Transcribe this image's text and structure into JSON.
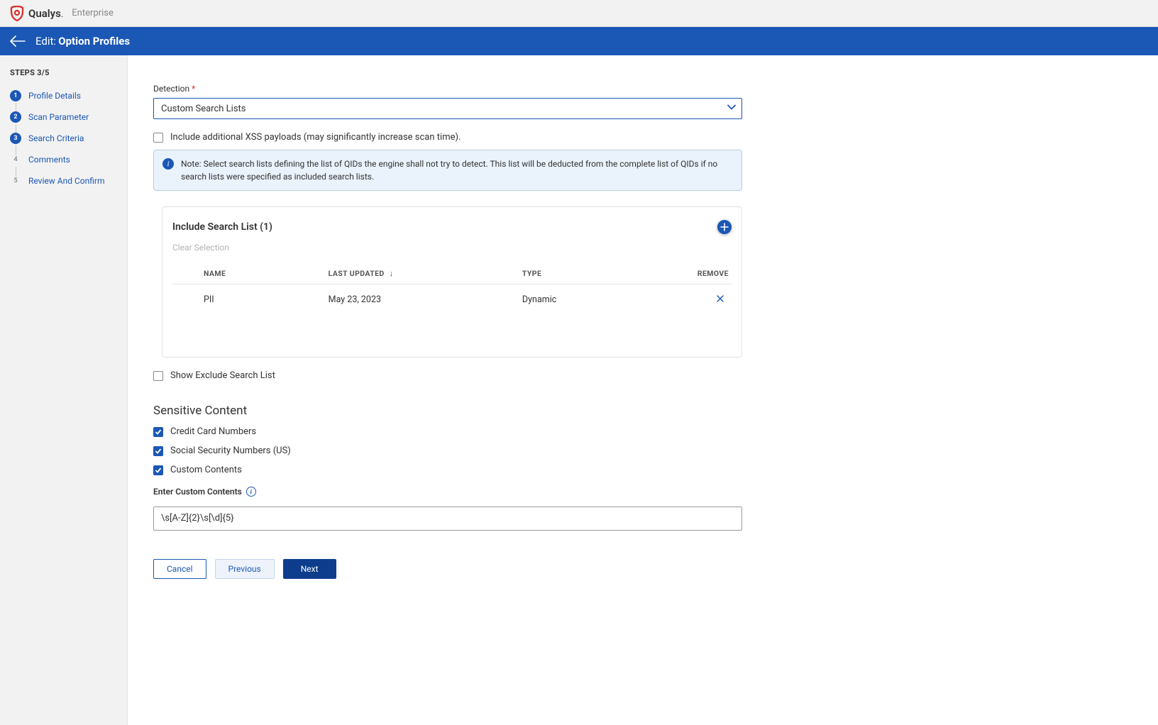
{
  "brand": {
    "name": "Qualys",
    "sub": "Enterprise"
  },
  "header": {
    "edit_label": "Edit:",
    "title": "Option Profiles"
  },
  "sidebar": {
    "steps_counter": "STEPS 3/5",
    "steps": [
      {
        "num": "1",
        "label": "Profile Details",
        "state": "done"
      },
      {
        "num": "2",
        "label": "Scan Parameter",
        "state": "done"
      },
      {
        "num": "3",
        "label": "Search Criteria",
        "state": "current"
      },
      {
        "num": "4",
        "label": "Comments",
        "state": "todo"
      },
      {
        "num": "5",
        "label": "Review And Confirm",
        "state": "todo"
      }
    ]
  },
  "detection": {
    "label": "Detection",
    "selected": "Custom Search Lists",
    "xss_label": "Include additional XSS payloads (may significantly increase scan time).",
    "xss_checked": false,
    "note": "Note: Select search lists defining the list of QIDs the engine shall not try to detect. This list will be deducted from the complete list of QIDs if no search lists were specified as included search lists."
  },
  "include_list": {
    "title": "Include Search List (1)",
    "clear": "Clear Selection",
    "columns": {
      "name": "NAME",
      "last_updated": "LAST UPDATED",
      "type": "TYPE",
      "remove": "REMOVE"
    },
    "rows": [
      {
        "name": "PII",
        "last_updated": "May 23, 2023",
        "type": "Dynamic"
      }
    ]
  },
  "exclude": {
    "label": "Show Exclude Search List",
    "checked": false
  },
  "sensitive": {
    "title": "Sensitive Content",
    "items": [
      {
        "label": "Credit Card Numbers",
        "checked": true
      },
      {
        "label": "Social Security Numbers (US)",
        "checked": true
      },
      {
        "label": "Custom Contents",
        "checked": true
      }
    ],
    "custom_label": "Enter Custom Contents",
    "custom_value": "\\s[A-Z]{2}\\s[\\d]{5}"
  },
  "buttons": {
    "cancel": "Cancel",
    "previous": "Previous",
    "next": "Next"
  }
}
